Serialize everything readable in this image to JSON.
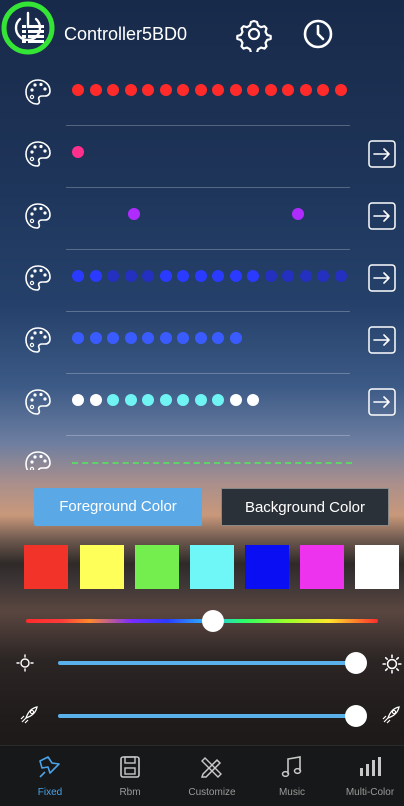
{
  "header": {
    "title": "Controller5BD0",
    "power_ring_color": "#35e535"
  },
  "rows": [
    {
      "dots": [
        "#ff2b2b",
        "#ff2b2b",
        "#ff2b2b",
        "#ff2b2b",
        "#ff2b2b",
        "#ff2b2b",
        "#ff2b2b",
        "#ff2b2b",
        "#ff2b2b",
        "#ff2b2b",
        "#ff2b2b",
        "#ff2b2b",
        "#ff2b2b",
        "#ff2b2b",
        "#ff2b2b",
        "#ff2b2b"
      ],
      "has_arrow": false
    },
    {
      "dots": [
        "#ff2f8c"
      ],
      "has_arrow": true
    },
    {
      "dots": [
        "#b02bff",
        "#b02bff"
      ],
      "has_arrow": true
    },
    {
      "dots": [
        "#2a3bff",
        "#2a3bff",
        "#2430c0",
        "#2430c0",
        "#2430c0",
        "#2a3bff",
        "#2a3bff",
        "#2a3bff",
        "#2a3bff",
        "#2a3bff",
        "#2a3bff",
        "#2430c0",
        "#2430c0",
        "#2430c0",
        "#2430c0",
        "#2430c0"
      ],
      "has_arrow": true
    },
    {
      "dots": [
        "#3a5cff",
        "#3a5cff",
        "#3a5cff",
        "#3a5cff",
        "#3a5cff",
        "#3a5cff",
        "#3a5cff",
        "#3a5cff",
        "#3a5cff",
        "#3a5cff"
      ],
      "has_arrow": true
    },
    {
      "dots": [
        "#ffffff",
        "#ffffff",
        "#6ff3f3",
        "#6ff3f3",
        "#6ff3f3",
        "#6ff3f3",
        "#6ff3f3",
        "#6ff3f3",
        "#6ff3f3",
        "#ffffff",
        "#ffffff"
      ],
      "has_arrow": true
    },
    {
      "dots": [],
      "has_arrow": false
    }
  ],
  "tabs": {
    "foreground": "Foreground Color",
    "background": "Background Color"
  },
  "swatches": [
    "#f2332a",
    "#ffff59",
    "#74ee4e",
    "#6ff7f7",
    "#0a0ef2",
    "#ee33ee",
    "#ffffff"
  ],
  "sliders": {
    "hue": 0.53,
    "brightness": 1.0,
    "speed": 1.0
  },
  "nav": [
    {
      "label": "Fixed",
      "active": true
    },
    {
      "label": "Rbm",
      "active": false
    },
    {
      "label": "Customize",
      "active": false
    },
    {
      "label": "Music",
      "active": false
    },
    {
      "label": "Multi-Color",
      "active": false
    }
  ]
}
